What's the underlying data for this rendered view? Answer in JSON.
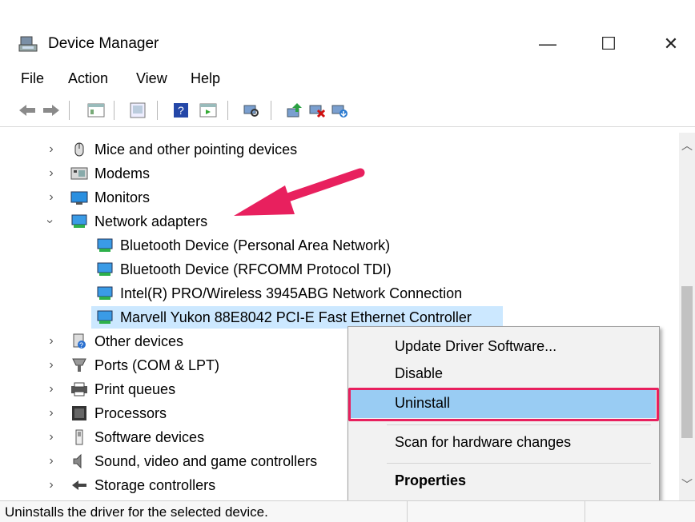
{
  "window": {
    "title": "Device Manager",
    "minimize": "—",
    "maximize": "☐",
    "close": "✕"
  },
  "menu": [
    "File",
    "Action",
    "View",
    "Help"
  ],
  "toolbar": [
    "back-icon",
    "forward-icon",
    "properties-view-icon",
    "show-hidden-icon",
    "help-icon",
    "action-view-icon",
    "scan-hardware-icon",
    "update-driver-icon",
    "uninstall-icon",
    "enable-device-icon"
  ],
  "tree": {
    "items": [
      {
        "label": "Mice and other pointing devices",
        "icon": "mouse-icon",
        "expanded": false
      },
      {
        "label": "Modems",
        "icon": "modem-icon",
        "expanded": false
      },
      {
        "label": "Monitors",
        "icon": "monitor-icon",
        "expanded": false
      },
      {
        "label": "Network adapters",
        "icon": "network-adapter-icon",
        "expanded": true
      },
      {
        "label": "Bluetooth Device (Personal Area Network)",
        "icon": "network-adapter-icon"
      },
      {
        "label": "Bluetooth Device (RFCOMM Protocol TDI)",
        "icon": "network-adapter-icon"
      },
      {
        "label": "Intel(R) PRO/Wireless 3945ABG Network Connection",
        "icon": "network-adapter-icon"
      },
      {
        "label": "Marvell Yukon 88E8042 PCI-E Fast Ethernet Controller",
        "icon": "network-adapter-icon",
        "selected": true
      },
      {
        "label": "Other devices",
        "icon": "unknown-device-icon",
        "expanded": false
      },
      {
        "label": "Ports (COM & LPT)",
        "icon": "port-icon",
        "expanded": false
      },
      {
        "label": "Print queues",
        "icon": "printer-icon",
        "expanded": false
      },
      {
        "label": "Processors",
        "icon": "processor-icon",
        "expanded": false
      },
      {
        "label": "Software devices",
        "icon": "software-device-icon",
        "expanded": false
      },
      {
        "label": "Sound, video and game controllers",
        "icon": "speaker-icon",
        "expanded": false
      },
      {
        "label": "Storage controllers",
        "icon": "storage-icon",
        "expanded": false
      }
    ]
  },
  "context_menu": {
    "items": [
      "Update Driver Software...",
      "Disable",
      "Uninstall",
      "Scan for hardware changes",
      "Properties"
    ],
    "highlighted": "Uninstall"
  },
  "status": {
    "text": "Uninstalls the driver for the selected device."
  },
  "colors": {
    "highlight": "#99ccf3",
    "selection": "#cce8ff",
    "annotation": "#e8205e"
  }
}
